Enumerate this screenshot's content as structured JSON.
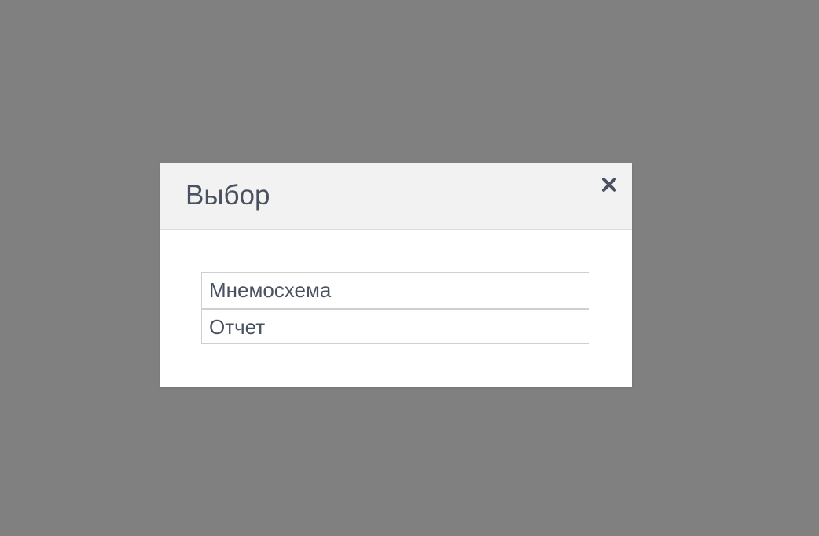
{
  "dialog": {
    "title": "Выбор",
    "close_icon": "close-icon",
    "options": [
      {
        "label": "Мнемосхема"
      },
      {
        "label": "Отчет"
      }
    ]
  },
  "colors": {
    "overlay": "#808080",
    "header_background": "#f2f2f2",
    "text": "#4a5261",
    "border": "#cfcfcf"
  }
}
